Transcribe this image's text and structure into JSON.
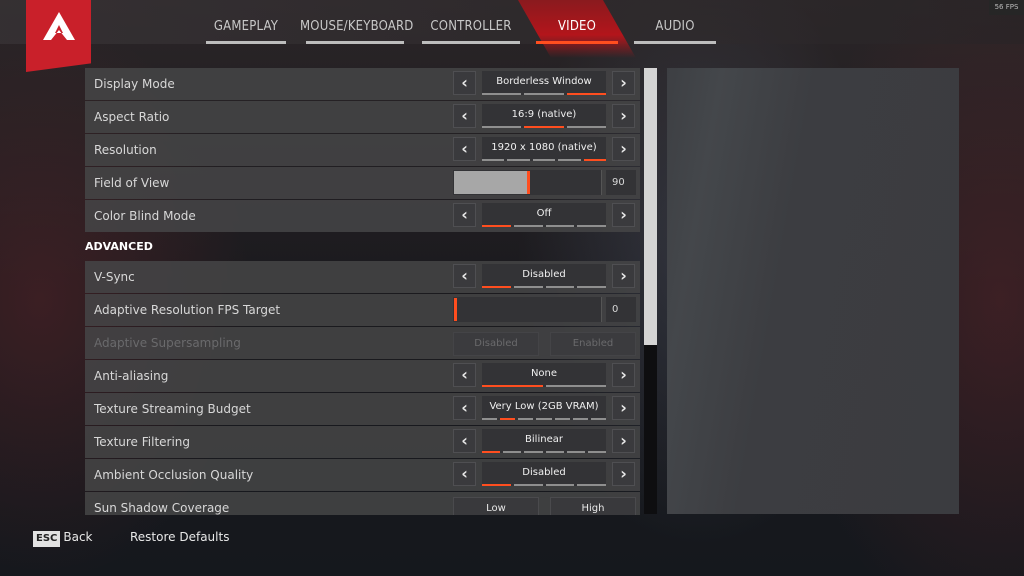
{
  "header": {
    "fps_counter": "56 FPS",
    "tabs": [
      {
        "label": "GAMEPLAY",
        "active": false
      },
      {
        "label": "MOUSE/KEYBOARD",
        "active": false
      },
      {
        "label": "CONTROLLER",
        "active": false
      },
      {
        "label": "VIDEO",
        "active": true
      },
      {
        "label": "AUDIO",
        "active": false
      }
    ]
  },
  "colors": {
    "accent": "#ff4e1f",
    "logo_red": "#c9202a",
    "active_tab": "#b3151b"
  },
  "settings": {
    "display_mode": {
      "label": "Display Mode",
      "value": "Borderless Window",
      "option_count": 3,
      "selected_index": 2
    },
    "aspect_ratio": {
      "label": "Aspect Ratio",
      "value": "16:9 (native)",
      "option_count": 3,
      "selected_index": 1
    },
    "resolution": {
      "label": "Resolution",
      "value": "1920 x 1080 (native)",
      "option_count": 5,
      "selected_index": 4
    },
    "field_of_view": {
      "label": "Field of View",
      "value": "90",
      "slider_fraction": 0.5
    },
    "color_blind_mode": {
      "label": "Color Blind Mode",
      "value": "Off",
      "option_count": 4,
      "selected_index": 0
    },
    "advanced_heading": "ADVANCED",
    "vsync": {
      "label": "V-Sync",
      "value": "Disabled",
      "option_count": 4,
      "selected_index": 0
    },
    "adaptive_res_fps": {
      "label": "Adaptive Resolution FPS Target",
      "value": "0",
      "slider_fraction": 0.0
    },
    "adaptive_supersampling": {
      "label": "Adaptive Supersampling",
      "option_a": "Disabled",
      "option_b": "Enabled",
      "disabled": true
    },
    "anti_aliasing": {
      "label": "Anti-aliasing",
      "value": "None",
      "option_count": 2,
      "selected_index": 0
    },
    "texture_streaming_budget": {
      "label": "Texture Streaming Budget",
      "value": "Very Low (2GB VRAM)",
      "option_count": 7,
      "selected_index": 1
    },
    "texture_filtering": {
      "label": "Texture Filtering",
      "value": "Bilinear",
      "option_count": 6,
      "selected_index": 0
    },
    "ambient_occlusion": {
      "label": "Ambient Occlusion Quality",
      "value": "Disabled",
      "option_count": 4,
      "selected_index": 0
    },
    "sun_shadow_coverage": {
      "label": "Sun Shadow Coverage",
      "option_a": "Low",
      "option_b": "High"
    }
  },
  "footer": {
    "esc_key": "ESC",
    "back_label": "Back",
    "restore_label": "Restore Defaults"
  },
  "scrollbar": {
    "visible_fraction": 0.62,
    "position_fraction": 0.0
  }
}
